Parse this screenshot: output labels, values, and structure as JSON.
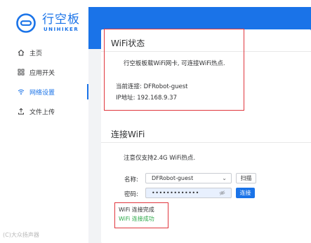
{
  "brand": {
    "name_cn": "行空板",
    "name_en": "UNIHIKER",
    "color": "#1a73e8"
  },
  "sidebar": {
    "items": [
      {
        "label": "主页",
        "icon": "home-icon",
        "active": false
      },
      {
        "label": "应用开关",
        "icon": "grid-icon",
        "active": false
      },
      {
        "label": "网络设置",
        "icon": "wifi-icon",
        "active": true
      },
      {
        "label": "文件上传",
        "icon": "upload-icon",
        "active": false
      }
    ]
  },
  "watermark": "(C)大众扬声器",
  "wifi_status": {
    "title": "WiFi状态",
    "description": "行空板板载WiFi网卡, 可连接WiFi热点.",
    "current_connection": "当前连接: DFRobot-guest",
    "ip_address": "IP地址: 192.168.9.37"
  },
  "connect_wifi": {
    "title": "连接WiFi",
    "note": "注意仅支持2.4G WiFi热点.",
    "name_label": "名称:",
    "ssid_selected": "DFRobot-guest",
    "scan_label": "扫描",
    "password_label": "密码:",
    "password_mask": "•••••••••••••",
    "connect_label": "连接",
    "status_complete": "WiFi 连接完成",
    "status_success": "WiFi 连接成功"
  },
  "colors": {
    "accent": "#1a73e8",
    "highlight": "#e0363d",
    "success": "#2ea94a"
  }
}
